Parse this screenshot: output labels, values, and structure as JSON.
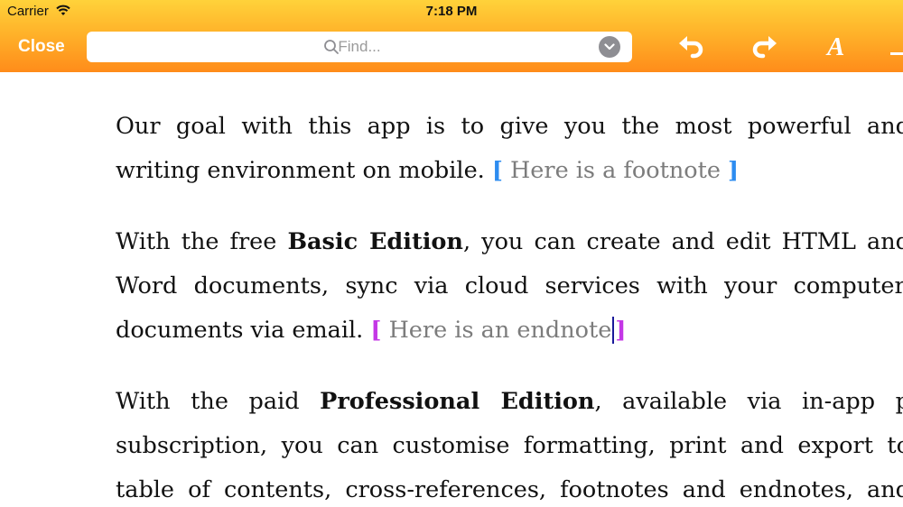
{
  "status_bar": {
    "carrier": "Carrier",
    "time": "7:18 PM"
  },
  "toolbar": {
    "close_label": "Close",
    "find_placeholder": "Find...",
    "find_value": "",
    "format_glyph": "A",
    "icons": [
      "wifi-icon",
      "search-icon",
      "chevron-down-icon",
      "undo-icon",
      "redo-icon",
      "format-font-icon",
      "more-icon"
    ],
    "accent_top": "#ffd23a",
    "accent_bottom": "#ff8c1a"
  },
  "document": {
    "p1": {
      "line1": "Our goal with this app is to give you the most powerful and",
      "line2": "writing environment on mobile.",
      "footnote_open": "[",
      "footnote_text": " Here is a footnote ",
      "footnote_close": "]"
    },
    "p2": {
      "line1_a": "With the free ",
      "line1_bold": "Basic Edition",
      "line1_b": ", you can create and edit HTML and",
      "line2": "Word documents, sync via cloud services with your computer,",
      "line3": "documents via email.",
      "endnote_open": "[",
      "endnote_text": " Here is an endnote",
      "endnote_close": "]"
    },
    "p3": {
      "line1_a": "With the paid ",
      "line1_bold": "Professional Edition",
      "line1_b": ", available via in-app p",
      "line2": "subscription, you can customise formatting, print and export to",
      "line3": "table of contents, cross-references, footnotes and endnotes, and"
    },
    "colors": {
      "footnote_bracket": "#2d8cf0",
      "endnote_bracket": "#c437e6",
      "note_text": "#7c7c7c"
    }
  }
}
